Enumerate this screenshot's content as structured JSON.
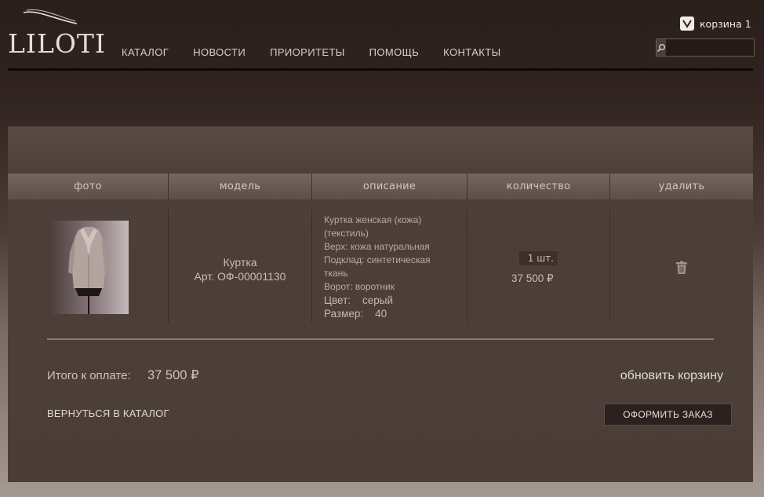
{
  "header": {
    "logo": "LILOTI",
    "nav": [
      "КАТАЛОГ",
      "НОВОСТИ",
      "ПРИОРИТЕТЫ",
      "ПОМОЩЬ",
      "КОНТАКТЫ"
    ],
    "cart_label": "корзина 1",
    "search_placeholder": ""
  },
  "cart_table": {
    "columns": [
      "фото",
      "модель",
      "описание",
      "количество",
      "удалить"
    ],
    "item": {
      "model_name": "Куртка",
      "article": "Арт. ОФ-00001130",
      "description": [
        "Куртка женская (кожа)",
        "(текстиль)",
        "Верх: кожа натуральная",
        "Подклад: синтетическая",
        "ткань",
        "Ворот: воротник"
      ],
      "color_label": "Цвет:",
      "color_value": "серый",
      "size_label": "Размер:",
      "size_value": "40",
      "quantity": "1 шт.",
      "price": "37 500 ₽"
    }
  },
  "summary": {
    "total_label": "Итого к оплате:",
    "total_value": "37 500 ₽",
    "update_cart": "обновить корзину",
    "back_to_catalog": "ВЕРНУТЬСЯ В КАТАЛОГ",
    "checkout": "ОФОРМИТЬ ЗАКАЗ"
  },
  "colors": {
    "background_top": "#2b1f1c",
    "panel": "#4d3f39",
    "text": "#d8ccc4"
  }
}
